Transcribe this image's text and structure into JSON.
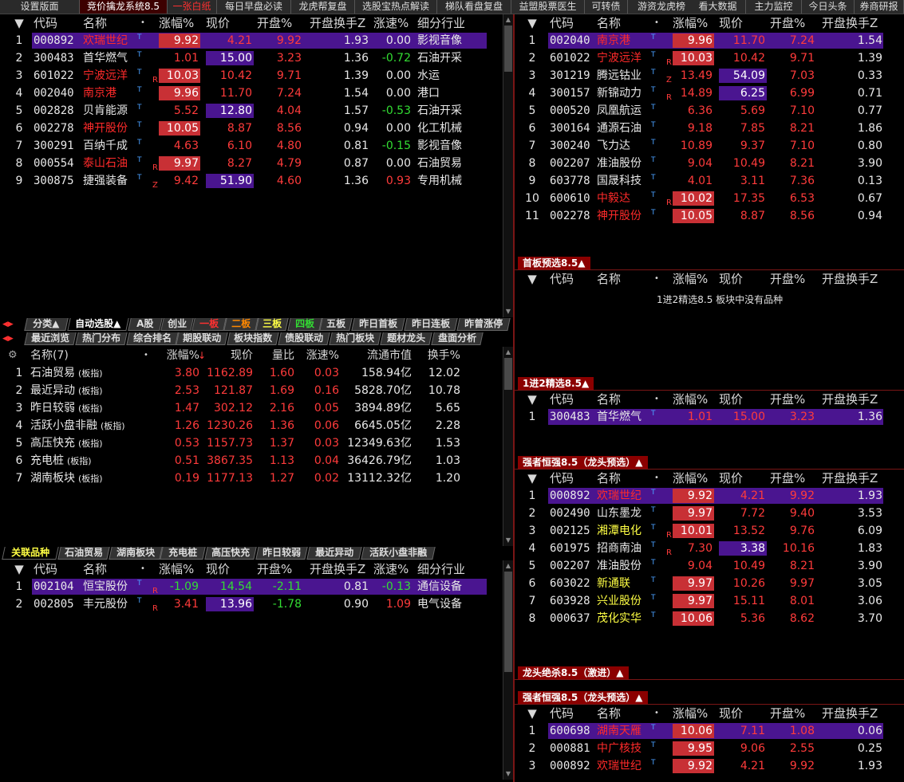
{
  "top_tabs": [
    "设置版面",
    "竞价擒龙系统8.5",
    "一张白纸",
    "每日早盘必读",
    "龙虎帮复盘",
    "选股宝热点解读",
    "梯队看盘复盘",
    "益盟股票医生",
    "可转债",
    "游资龙虎榜",
    "看大数据",
    "主力监控",
    "今日头条",
    "券商研报"
  ],
  "headers": {
    "main": [
      "代码",
      "名称",
      "涨幅%",
      "现价",
      "开盘%",
      "开盘换手Z",
      "涨速%",
      "细分行业"
    ],
    "right": [
      "代码",
      "名称",
      "涨幅%",
      "现价",
      "开盘%",
      "开盘换手Z"
    ],
    "sector": [
      "名称(7)",
      "涨幅%",
      "现价",
      "量比",
      "涨速%",
      "流通市值",
      "换手%"
    ]
  },
  "top_left_rows": [
    {
      "n": "1",
      "code": "000892",
      "name": "欢瑞世纪",
      "tag": "",
      "chg": "9.92",
      "price": "4.21",
      "open": "9.92",
      "turn": "1.93",
      "speed": "0.00",
      "ind": "影视音像"
    },
    {
      "n": "2",
      "code": "300483",
      "name": "首华燃气",
      "tag": "",
      "chg": "1.01",
      "price": "15.00",
      "open": "3.23",
      "turn": "1.36",
      "speed": "-0.72",
      "ind": "石油开采"
    },
    {
      "n": "3",
      "code": "601022",
      "name": "宁波远洋",
      "tag": "R",
      "chg": "10.03",
      "price": "10.42",
      "open": "9.71",
      "turn": "1.39",
      "speed": "0.00",
      "ind": "水运"
    },
    {
      "n": "4",
      "code": "002040",
      "name": "南京港",
      "tag": "",
      "chg": "9.96",
      "price": "11.70",
      "open": "7.24",
      "turn": "1.54",
      "speed": "0.00",
      "ind": "港口"
    },
    {
      "n": "5",
      "code": "002828",
      "name": "贝肯能源",
      "tag": "",
      "chg": "5.52",
      "price": "12.80",
      "open": "4.04",
      "turn": "1.57",
      "speed": "-0.53",
      "ind": "石油开采"
    },
    {
      "n": "6",
      "code": "002278",
      "name": "神开股份",
      "tag": "",
      "chg": "10.05",
      "price": "8.87",
      "open": "8.56",
      "turn": "0.94",
      "speed": "0.00",
      "ind": "化工机械"
    },
    {
      "n": "7",
      "code": "300291",
      "name": "百纳千成",
      "tag": "",
      "chg": "4.63",
      "price": "6.10",
      "open": "4.80",
      "turn": "0.81",
      "speed": "-0.15",
      "ind": "影视音像"
    },
    {
      "n": "8",
      "code": "000554",
      "name": "泰山石油",
      "tag": "R",
      "chg": "9.97",
      "price": "8.27",
      "open": "4.79",
      "turn": "0.87",
      "speed": "0.00",
      "ind": "石油贸易"
    },
    {
      "n": "9",
      "code": "300875",
      "name": "捷强装备",
      "tag": "Z",
      "chg": "9.42",
      "price": "51.90",
      "open": "4.60",
      "turn": "1.36",
      "speed": "0.93",
      "ind": "专用机械"
    }
  ],
  "strip1": [
    "分类▲",
    "自动选股▲",
    "A股",
    "创业",
    "一板",
    "二板",
    "三板",
    "四板",
    "五板",
    "昨日首板",
    "昨日连板",
    "昨曾涨停"
  ],
  "strip2": [
    "最近浏览",
    "热门分布",
    "综合排名",
    "期股联动",
    "板块指数",
    "债股联动",
    "热门板块",
    "题材龙头",
    "盘面分析"
  ],
  "sector_rows": [
    {
      "n": "1",
      "name": "石油贸易",
      "suffix": "(板指)",
      "chg": "3.80",
      "price": "1162.89",
      "vol": "1.60",
      "speed": "0.03",
      "cap": "158.94亿",
      "turn": "12.02"
    },
    {
      "n": "2",
      "name": "最近异动",
      "suffix": "(板指)",
      "chg": "2.53",
      "price": "121.87",
      "vol": "1.69",
      "speed": "0.16",
      "cap": "5828.70亿",
      "turn": "10.78"
    },
    {
      "n": "3",
      "name": "昨日较弱",
      "suffix": "(板指)",
      "chg": "1.47",
      "price": "302.12",
      "vol": "2.16",
      "speed": "0.05",
      "cap": "3894.89亿",
      "turn": "5.65"
    },
    {
      "n": "4",
      "name": "活跃小盘非融",
      "suffix": "(板指)",
      "chg": "1.26",
      "price": "1230.26",
      "vol": "1.36",
      "speed": "0.06",
      "cap": "6645.05亿",
      "turn": "2.28"
    },
    {
      "n": "5",
      "name": "高压快充",
      "suffix": "(板指)",
      "chg": "0.53",
      "price": "1157.73",
      "vol": "1.37",
      "speed": "0.03",
      "cap": "12349.63亿",
      "turn": "1.53"
    },
    {
      "n": "6",
      "name": "充电桩",
      "suffix": "(板指)",
      "chg": "0.51",
      "price": "3867.35",
      "vol": "1.13",
      "speed": "0.04",
      "cap": "36426.79亿",
      "turn": "1.03"
    },
    {
      "n": "7",
      "name": "湖南板块",
      "suffix": "(板指)",
      "chg": "0.19",
      "price": "1177.13",
      "vol": "1.27",
      "speed": "0.02",
      "cap": "13112.32亿",
      "turn": "1.20"
    }
  ],
  "strip3": [
    "关联品种",
    "石油贸易",
    "湖南板块",
    "充电桩",
    "高压快充",
    "昨日较弱",
    "最近异动",
    "活跃小盘非融"
  ],
  "related_rows": [
    {
      "n": "1",
      "code": "002104",
      "name": "恒宝股份",
      "tag": "R",
      "chg": "-1.09",
      "price": "14.54",
      "open": "-2.11",
      "turn": "0.81",
      "speed": "-0.13",
      "ind": "通信设备"
    },
    {
      "n": "2",
      "code": "002805",
      "name": "丰元股份",
      "tag": "R",
      "chg": "3.41",
      "price": "13.96",
      "open": "-1.78",
      "turn": "0.90",
      "speed": "1.09",
      "ind": "电气设备"
    }
  ],
  "right_top_rows": [
    {
      "n": "1",
      "code": "002040",
      "name": "南京港",
      "tag": "",
      "chg": "9.96",
      "price": "11.70",
      "open": "7.24",
      "turn": "1.54"
    },
    {
      "n": "2",
      "code": "601022",
      "name": "宁波远洋",
      "tag": "R",
      "chg": "10.03",
      "price": "10.42",
      "open": "9.71",
      "turn": "1.39"
    },
    {
      "n": "3",
      "code": "301219",
      "name": "腾远钴业",
      "tag": "Z",
      "chg": "13.49",
      "price": "54.09",
      "open": "7.03",
      "turn": "0.33"
    },
    {
      "n": "4",
      "code": "300157",
      "name": "新锦动力",
      "tag": "R",
      "chg": "14.89",
      "price": "6.25",
      "open": "6.99",
      "turn": "0.71"
    },
    {
      "n": "5",
      "code": "000520",
      "name": "凤凰航运",
      "tag": "",
      "chg": "6.36",
      "price": "5.69",
      "open": "7.10",
      "turn": "0.77"
    },
    {
      "n": "6",
      "code": "300164",
      "name": "通源石油",
      "tag": "",
      "chg": "9.18",
      "price": "7.85",
      "open": "8.21",
      "turn": "1.86"
    },
    {
      "n": "7",
      "code": "300240",
      "name": "飞力达",
      "tag": "",
      "chg": "10.89",
      "price": "9.37",
      "open": "7.10",
      "turn": "0.80"
    },
    {
      "n": "8",
      "code": "002207",
      "name": "准油股份",
      "tag": "",
      "chg": "9.04",
      "price": "10.49",
      "open": "8.21",
      "turn": "3.90"
    },
    {
      "n": "9",
      "code": "603778",
      "name": "国晟科技",
      "tag": "",
      "chg": "4.01",
      "price": "3.11",
      "open": "7.36",
      "turn": "0.13"
    },
    {
      "n": "10",
      "code": "600610",
      "name": "中毅达",
      "tag": "R",
      "chg": "10.02",
      "price": "17.35",
      "open": "6.53",
      "turn": "0.67"
    },
    {
      "n": "11",
      "code": "002278",
      "name": "神开股份",
      "tag": "",
      "chg": "10.05",
      "price": "8.87",
      "open": "8.56",
      "turn": "0.94"
    }
  ],
  "sections": {
    "s1": "首板预选8.5▲",
    "s1_msg": "1进2精选8.5 板块中没有品种",
    "s2": "1进2精选8.5▲",
    "s3": "强者恒强8.5（龙头预选）▲",
    "s4": "龙头绝杀8.5（激进）▲",
    "s5": "强者恒强8.5（龙头预选）▲"
  },
  "s2_rows": [
    {
      "n": "1",
      "code": "300483",
      "name": "首华燃气",
      "tag": "",
      "chg": "1.01",
      "price": "15.00",
      "open": "3.23",
      "turn": "1.36"
    }
  ],
  "s3_rows": [
    {
      "n": "1",
      "code": "000892",
      "name": "欢瑞世纪",
      "tag": "",
      "chg": "9.92",
      "price": "4.21",
      "open": "9.92",
      "turn": "1.93"
    },
    {
      "n": "2",
      "code": "002490",
      "name": "山东墨龙",
      "tag": "",
      "chg": "9.97",
      "price": "7.72",
      "open": "9.40",
      "turn": "3.53"
    },
    {
      "n": "3",
      "code": "002125",
      "name": "湘潭电化",
      "tag": "R",
      "chg": "10.01",
      "price": "13.52",
      "open": "9.76",
      "turn": "6.09"
    },
    {
      "n": "4",
      "code": "601975",
      "name": "招商南油",
      "tag": "R",
      "chg": "7.30",
      "price": "3.38",
      "open": "10.16",
      "turn": "1.83"
    },
    {
      "n": "5",
      "code": "002207",
      "name": "准油股份",
      "tag": "",
      "chg": "9.04",
      "price": "10.49",
      "open": "8.21",
      "turn": "3.90"
    },
    {
      "n": "6",
      "code": "603022",
      "name": "新通联",
      "tag": "",
      "chg": "9.97",
      "price": "10.26",
      "open": "9.97",
      "turn": "3.05"
    },
    {
      "n": "7",
      "code": "603928",
      "name": "兴业股份",
      "tag": "",
      "chg": "9.97",
      "price": "15.11",
      "open": "8.01",
      "turn": "3.06"
    },
    {
      "n": "8",
      "code": "000637",
      "name": "茂化实华",
      "tag": "",
      "chg": "10.06",
      "price": "5.36",
      "open": "8.62",
      "turn": "3.70"
    }
  ],
  "s5_rows": [
    {
      "n": "1",
      "code": "600698",
      "name": "湖南天雁",
      "tag": "",
      "chg": "10.06",
      "price": "7.11",
      "open": "1.08",
      "turn": "0.06"
    },
    {
      "n": "2",
      "code": "000881",
      "name": "中广核技",
      "tag": "",
      "chg": "9.95",
      "price": "9.06",
      "open": "2.55",
      "turn": "0.25"
    },
    {
      "n": "3",
      "code": "000892",
      "name": "欢瑞世纪",
      "tag": "",
      "chg": "9.92",
      "price": "4.21",
      "open": "9.92",
      "turn": "1.93"
    }
  ],
  "colors": {
    "accent_red": "#c83035",
    "select_purple": "#4a1590",
    "up": "#ff3b3b",
    "down": "#33dd33",
    "tab_red": "#8b0000"
  }
}
